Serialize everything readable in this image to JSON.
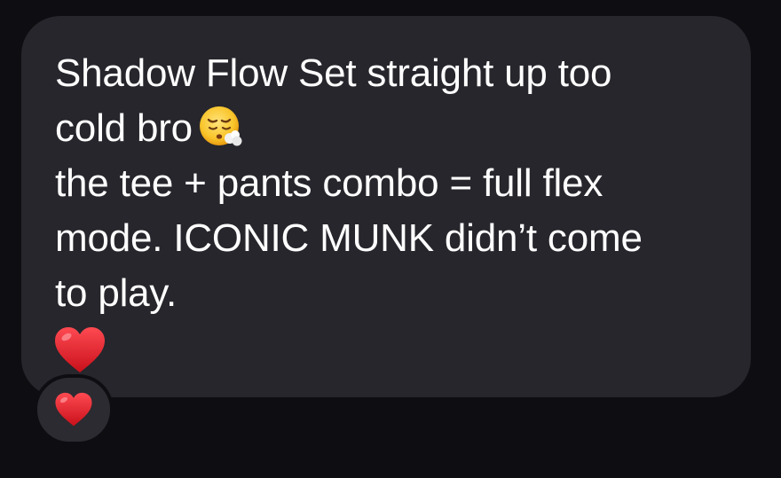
{
  "message": {
    "line1": "Shadow Flow Set straight up too",
    "line2": "cold bro",
    "line3": "the tee + pants combo = full flex",
    "line4": "mode. ICONIC MUNK didn’t come",
    "line5": "to play.",
    "face_emoji_icon": "exhaling-face-icon",
    "heart_emoji_icon": "red-heart-icon"
  },
  "reaction": {
    "icon": "red-heart-icon"
  },
  "colors": {
    "background": "#0e0e12",
    "bubble": "#26262c",
    "text": "#ffffff",
    "heart": "#e0202a"
  }
}
